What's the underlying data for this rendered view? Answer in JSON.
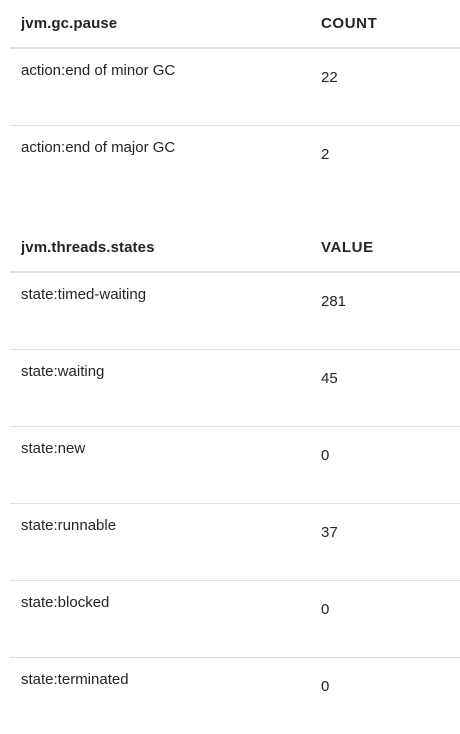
{
  "tables": [
    {
      "metric": "jvm.gc.pause",
      "value_header": "COUNT",
      "rows": [
        {
          "tag": "action:end of minor GC",
          "value": "22"
        },
        {
          "tag": "action:end of major GC",
          "value": "2"
        }
      ]
    },
    {
      "metric": "jvm.threads.states",
      "value_header": "VALUE",
      "rows": [
        {
          "tag": "state:timed-waiting",
          "value": "281"
        },
        {
          "tag": "state:waiting",
          "value": "45"
        },
        {
          "tag": "state:new",
          "value": "0"
        },
        {
          "tag": "state:runnable",
          "value": "37"
        },
        {
          "tag": "state:blocked",
          "value": "0"
        },
        {
          "tag": "state:terminated",
          "value": "0"
        }
      ]
    }
  ]
}
